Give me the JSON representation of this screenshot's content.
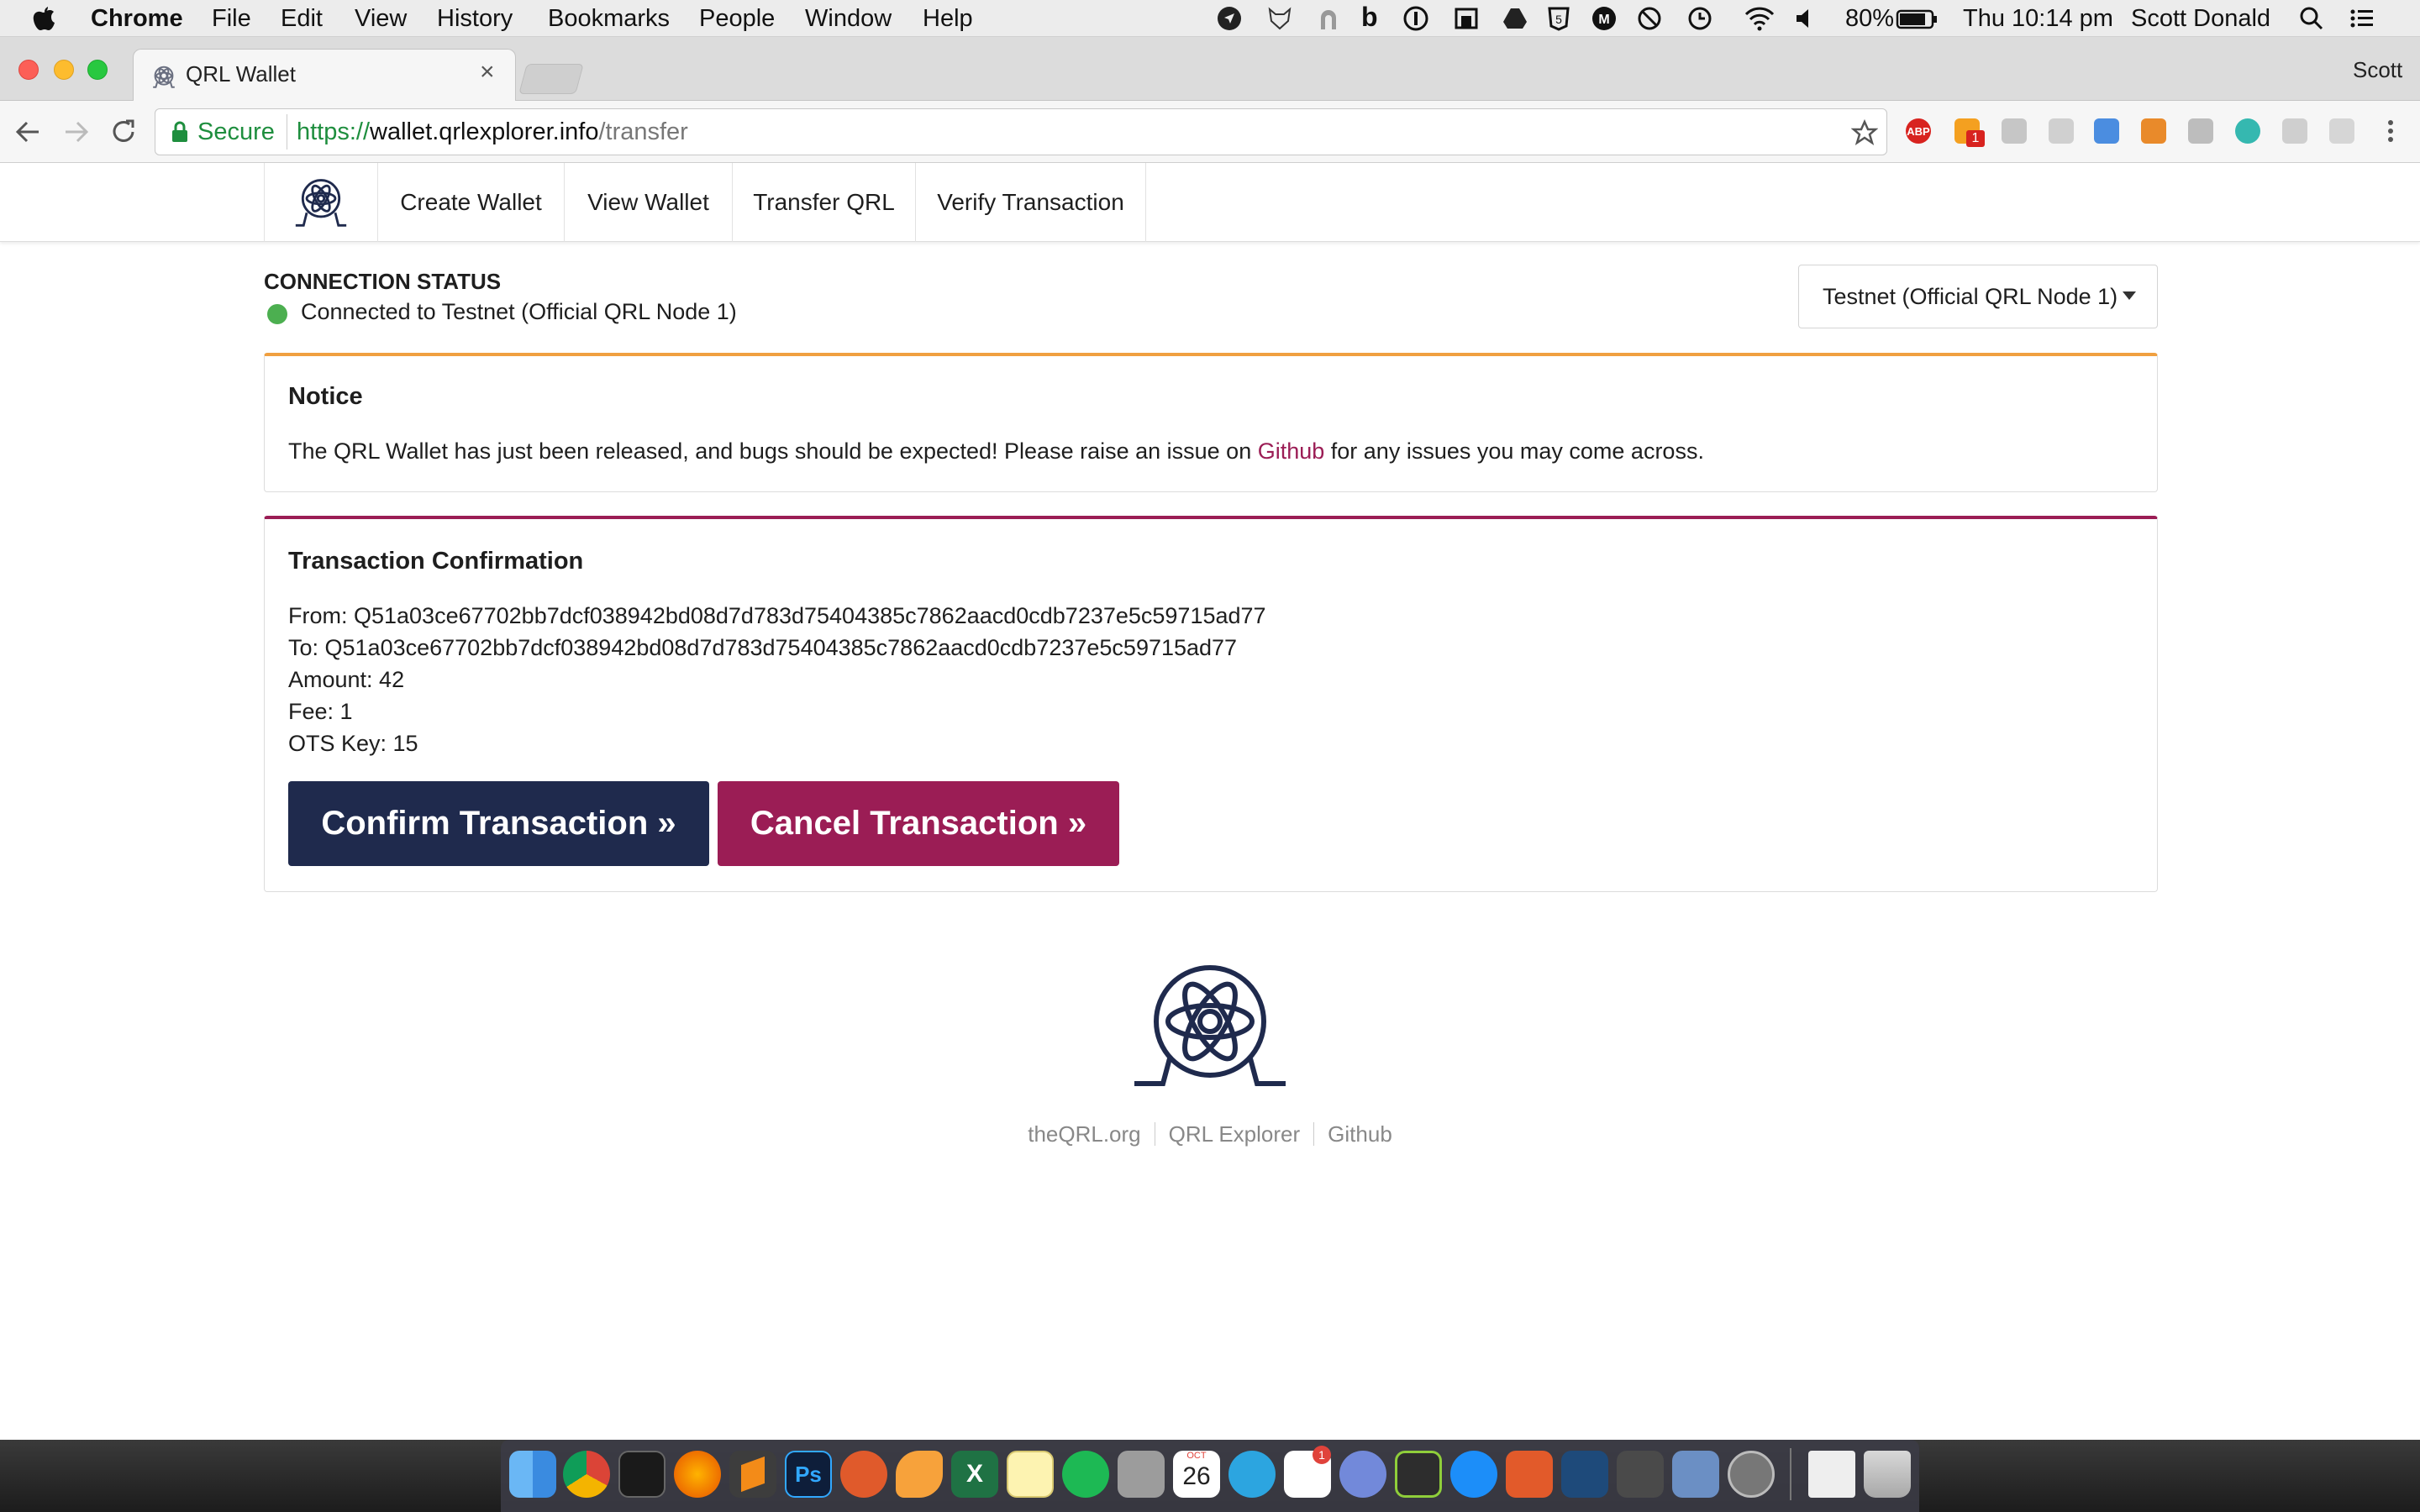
{
  "menubar": {
    "app": "Chrome",
    "items": [
      "File",
      "Edit",
      "View",
      "History",
      "Bookmarks",
      "People",
      "Window",
      "Help"
    ],
    "battery": "80%",
    "clock": "Thu 10:14 pm",
    "user": "Scott Donald"
  },
  "browser": {
    "tab_title": "QRL Wallet",
    "profile": "Scott",
    "secure_label": "Secure",
    "url_scheme": "https://",
    "url_host": "wallet.qrlexplorer.info",
    "url_path": "/transfer",
    "adblock": "ABP",
    "ext_badge": "1"
  },
  "nav": {
    "items": [
      "Create Wallet",
      "View Wallet",
      "Transfer QRL",
      "Verify Transaction"
    ]
  },
  "connection": {
    "heading": "CONNECTION STATUS",
    "status": "Connected to Testnet (Official QRL Node 1)",
    "status_color": "#4caf50",
    "node_select": "Testnet (Official QRL Node 1)"
  },
  "notice": {
    "title": "Notice",
    "text_before": "The QRL Wallet has just been released, and bugs should be expected! Please raise an issue on ",
    "link": "Github",
    "text_after": " for any issues you may come across.",
    "accent": "#f0a040"
  },
  "transaction": {
    "title": "Transaction Confirmation",
    "from": "From: Q51a03ce67702bb7dcf038942bd08d7d783d75404385c7862aacd0cdb7237e5c59715ad77",
    "to": "To: Q51a03ce67702bb7dcf038942bd08d7d783d75404385c7862aacd0cdb7237e5c59715ad77",
    "amount": "Amount: 42",
    "fee": "Fee: 1",
    "ots": "OTS Key: 15",
    "confirm_label": "Confirm Transaction »",
    "cancel_label": "Cancel Transaction »",
    "accent": "#9b1d55",
    "confirm_color": "#1f2a4d",
    "cancel_color": "#9b1d55"
  },
  "footer": {
    "links": [
      "theQRL.org",
      "QRL Explorer",
      "Github"
    ]
  },
  "dock": {
    "calendar_month": "OCT",
    "calendar_day": "26",
    "badge_slack": "1",
    "badge_discord": "1"
  }
}
